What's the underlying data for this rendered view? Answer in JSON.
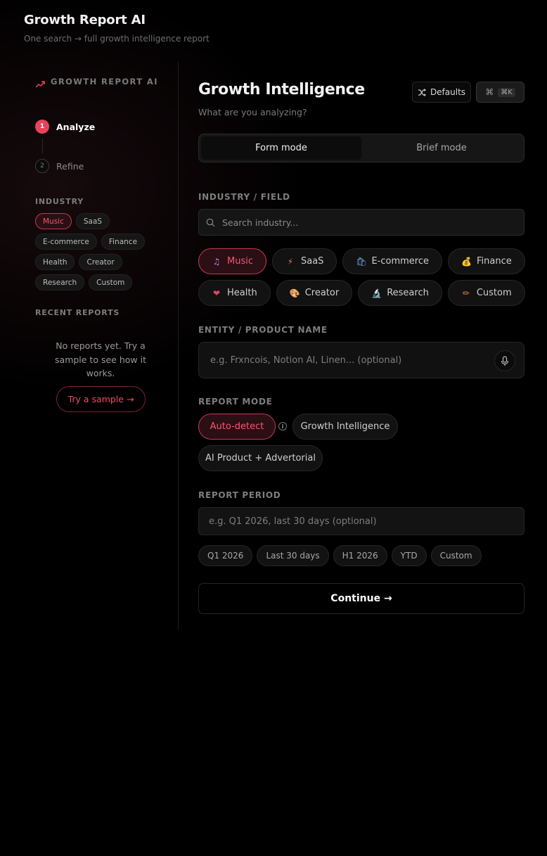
{
  "app": {
    "title": "Growth Report AI",
    "subtitle": "One search → full growth intelligence report"
  },
  "sidebar": {
    "brand": "GROWTH REPORT AI",
    "steps": [
      {
        "num": "1",
        "label": "Analyze",
        "active": true
      },
      {
        "num": "2",
        "label": "Refine",
        "active": false
      }
    ],
    "industry_heading": "INDUSTRY",
    "industries": [
      "Music",
      "SaaS",
      "E-commerce",
      "Finance",
      "Health",
      "Creator",
      "Research",
      "Custom"
    ],
    "active_industry": "Music",
    "recent_heading": "RECENT REPORTS",
    "empty_message": "No reports yet. Try a sample to see how it works.",
    "sample_button": "Try a sample →"
  },
  "main": {
    "title": "Growth Intelligence",
    "subtitle": "What are you analyzing?",
    "defaults_button": "Defaults",
    "shortcut_label": "⌘K",
    "modes": [
      "Form mode",
      "Brief mode"
    ],
    "active_mode": "Form mode",
    "industry_field": {
      "label": "INDUSTRY / FIELD",
      "placeholder": "Search industry...",
      "chips": [
        {
          "label": "Music",
          "icon": "music-note-icon",
          "glyph": "♫",
          "active": true
        },
        {
          "label": "SaaS",
          "icon": "lightning-icon",
          "glyph": "⚡",
          "active": false
        },
        {
          "label": "E-commerce",
          "icon": "shopping-bag-icon",
          "glyph": "🛍",
          "active": false
        },
        {
          "label": "Finance",
          "icon": "money-bag-icon",
          "glyph": "💰",
          "active": false
        },
        {
          "label": "Health",
          "icon": "heart-icon",
          "glyph": "❤",
          "active": false
        },
        {
          "label": "Creator",
          "icon": "palette-icon",
          "glyph": "🎨",
          "active": false
        },
        {
          "label": "Research",
          "icon": "microscope-icon",
          "glyph": "🔬",
          "active": false
        },
        {
          "label": "Custom",
          "icon": "pencil-icon",
          "glyph": "✏",
          "active": false
        }
      ]
    },
    "entity_field": {
      "label": "ENTITY / PRODUCT NAME",
      "placeholder": "e.g. Frxncois, Notion AI, Linen... (optional)"
    },
    "report_mode": {
      "label": "REPORT MODE",
      "options": [
        "Auto-detect",
        "Growth Intelligence",
        "AI Product + Advertorial"
      ],
      "active": "Auto-detect",
      "info_glyph": "i"
    },
    "report_period": {
      "label": "REPORT PERIOD",
      "placeholder": "e.g. Q1 2026, last 30 days (optional)",
      "presets": [
        "Q1 2026",
        "Last 30 days",
        "H1 2026",
        "YTD",
        "Custom"
      ]
    },
    "continue_button": "Continue →"
  },
  "colors": {
    "accent": "#e8435a",
    "background": "#000000"
  }
}
